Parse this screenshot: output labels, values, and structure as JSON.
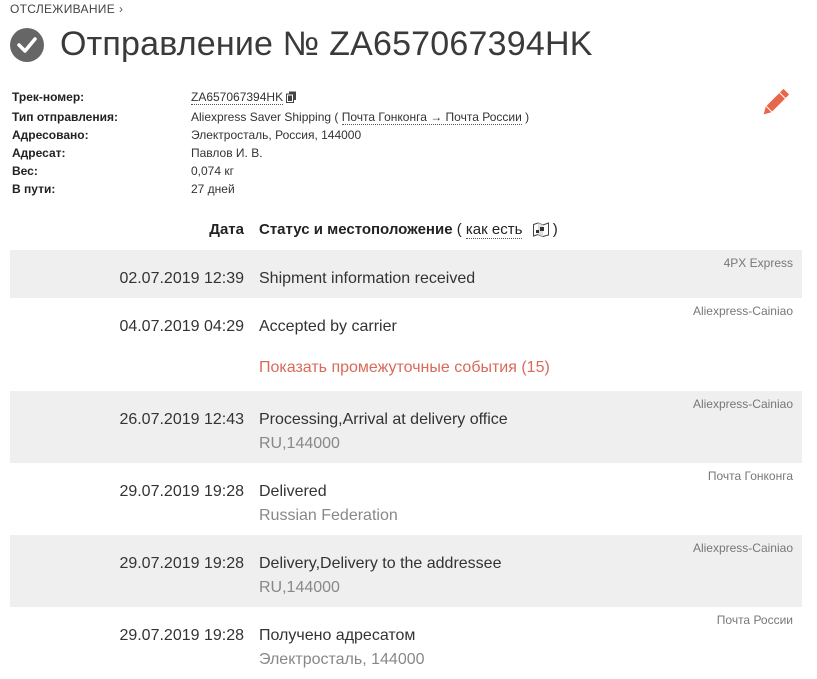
{
  "breadcrumb": {
    "label": "ОТСЛЕЖИВАНИЕ",
    "chevron": "›"
  },
  "title": "Отправление № ZA657067394HK",
  "info": [
    {
      "label": "Трек-номер:",
      "value": "ZA657067394HK"
    },
    {
      "label": "Тип отправления:",
      "value": "Aliexpress Saver Shipping",
      "route_open": "(",
      "route_link": "Почта Гонконга → Почта России",
      "route_close": ")"
    },
    {
      "label": "Адресовано:",
      "value": "Электросталь, Россия, 144000"
    },
    {
      "label": "Адресат:",
      "value": "Павлов И. В."
    },
    {
      "label": "Вес:",
      "value": "0,074 кг"
    },
    {
      "label": "В пути:",
      "value": "27 дней"
    }
  ],
  "events_header": {
    "date": "Дата",
    "status": "Статус и местоположение",
    "paren_open": "(",
    "as_is_link": "как есть",
    "paren_close": ")"
  },
  "events": [
    {
      "date": "02.07.2019 12:39",
      "status": "Shipment information received",
      "location": "",
      "operator": "4PX Express"
    },
    {
      "date": "04.07.2019 04:29",
      "status": "Accepted by carrier",
      "location": "",
      "operator": "Aliexpress-Cainiao",
      "show_more": "Показать промежуточные события (15)"
    },
    {
      "date": "26.07.2019 12:43",
      "status": "Processing,Arrival at delivery office",
      "location": "RU,144000",
      "operator": "Aliexpress-Cainiao"
    },
    {
      "date": "29.07.2019 19:28",
      "status": "Delivered",
      "location": "Russian Federation",
      "operator": "Почта Гонконга"
    },
    {
      "date": "29.07.2019 19:28",
      "status": "Delivery,Delivery to the addressee",
      "location": "RU,144000",
      "operator": "Aliexpress-Cainiao"
    },
    {
      "date": "29.07.2019 19:28",
      "status": "Получено адресатом",
      "location": "Электросталь, 144000",
      "operator": "Почта России"
    }
  ],
  "colors": {
    "accent_link": "#d96a5a",
    "row_shade": "#efefef",
    "pencil": "#e8674a"
  },
  "icons": {
    "status": "check-circle-icon",
    "copy": "copy-icon",
    "edit": "pencil-icon",
    "map": "map-icon"
  }
}
